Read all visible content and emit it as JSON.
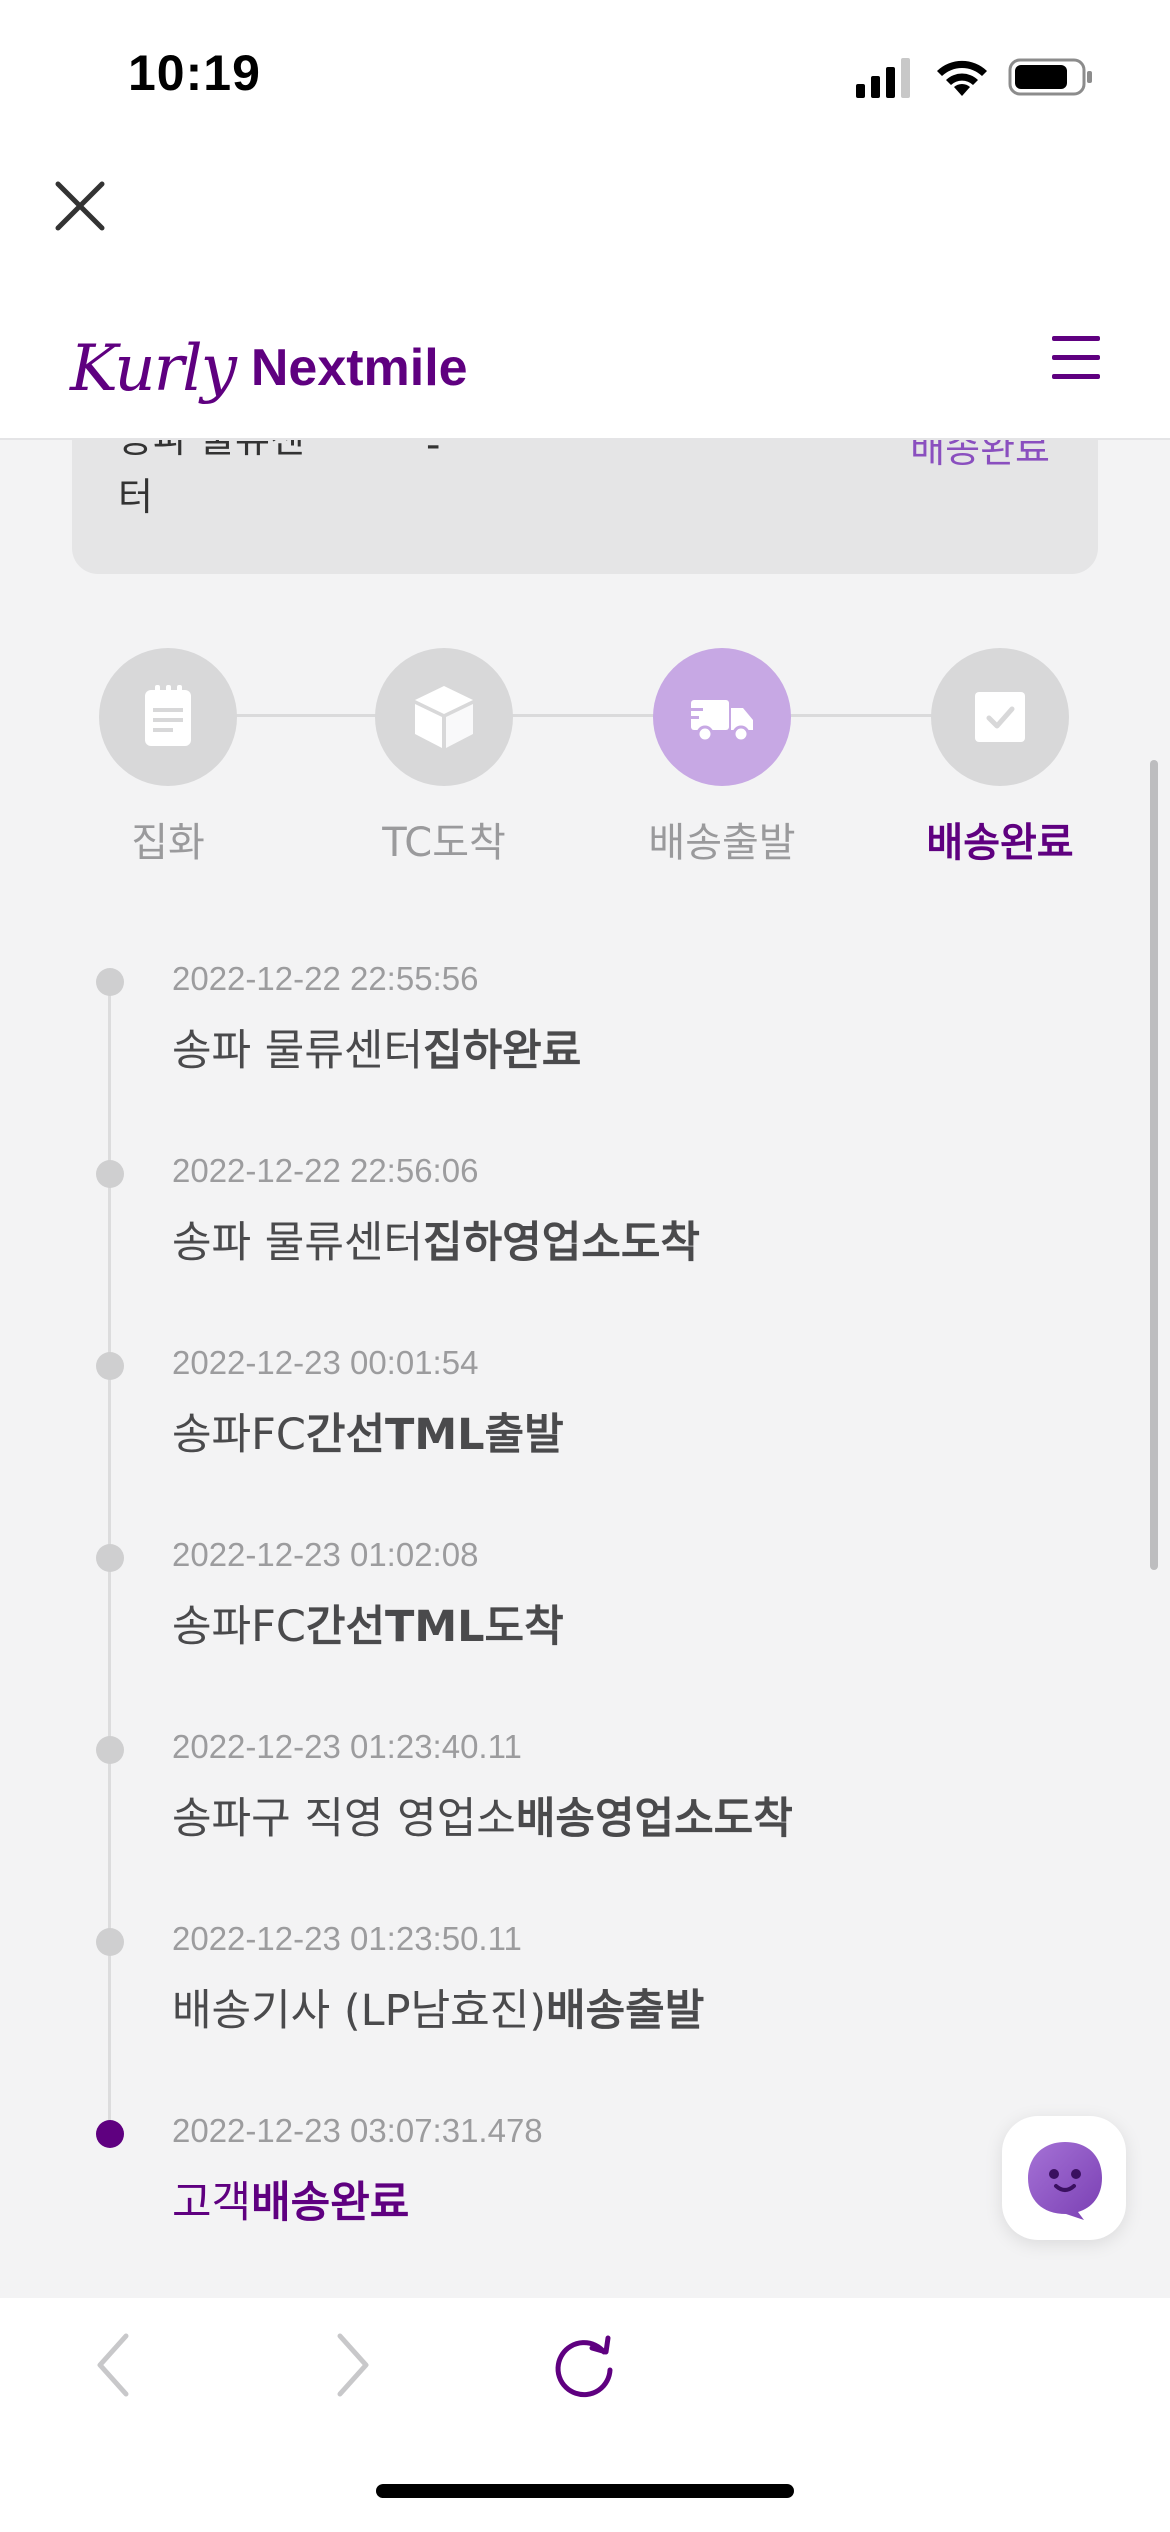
{
  "status_bar": {
    "time": "10:19"
  },
  "brand": {
    "script": "Kurly",
    "word": "Nextmile",
    "color": "#5f0080"
  },
  "summary_card": {
    "center_label": "송파 물류센터",
    "value": "-",
    "status": "배송완료"
  },
  "steps": [
    {
      "label": "집화",
      "icon": "clipboard-icon",
      "state": "done"
    },
    {
      "label": "TC도착",
      "icon": "box-icon",
      "state": "done"
    },
    {
      "label": "배송출발",
      "icon": "truck-icon",
      "state": "active"
    },
    {
      "label": "배송완료",
      "icon": "check-icon",
      "state": "current"
    }
  ],
  "timeline": [
    {
      "time": "2022-12-22 22:55:56",
      "place": "송파 물류센터",
      "event": "집하완료"
    },
    {
      "time": "2022-12-22 22:56:06",
      "place": "송파 물류센터",
      "event": "집하영업소도착"
    },
    {
      "time": "2022-12-23 00:01:54",
      "place": "송파FC",
      "event": "간선TML출발"
    },
    {
      "time": "2022-12-23 01:02:08",
      "place": "송파FC",
      "event": "간선TML도착"
    },
    {
      "time": "2022-12-23 01:23:40.11",
      "place": "송파구 직영 영업소",
      "event": "배송영업소도착"
    },
    {
      "time": "2022-12-23 01:23:50.11",
      "place": "배송기사 (LP남효진)",
      "event": "배송출발"
    },
    {
      "time": "2022-12-23 03:07:31.478",
      "place": "고객",
      "event": "배송완료"
    }
  ],
  "icons": {
    "close": "close-icon",
    "menu": "hamburger-menu-icon",
    "chat": "chatbot-icon",
    "back": "chevron-left-icon",
    "forward": "chevron-right-icon",
    "reload": "reload-icon"
  }
}
